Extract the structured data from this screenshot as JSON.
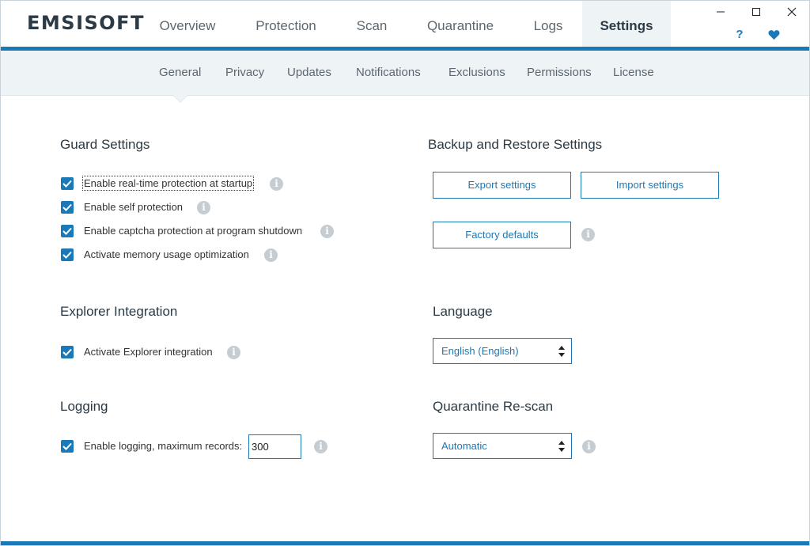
{
  "app": {
    "logo": "EMSISOFT"
  },
  "main_tabs": [
    "Overview",
    "Protection",
    "Scan",
    "Quarantine",
    "Logs",
    "Settings"
  ],
  "active_tab": "Settings",
  "window_controls": {
    "minimize": "minimize",
    "maximize": "maximize",
    "close": "close"
  },
  "header_icons": {
    "help": "?",
    "favorite": "heart-icon"
  },
  "sub_tabs": [
    "General",
    "Privacy",
    "Updates",
    "Notifications",
    "Exclusions",
    "Permissions",
    "License"
  ],
  "active_sub_tab": "General",
  "guard": {
    "title": "Guard Settings",
    "items": [
      {
        "label": "Enable real-time protection at startup",
        "checked": true
      },
      {
        "label": "Enable self protection",
        "checked": true
      },
      {
        "label": "Enable captcha protection at program shutdown",
        "checked": true
      },
      {
        "label": "Activate memory usage optimization",
        "checked": true
      }
    ]
  },
  "explorer": {
    "title": "Explorer Integration",
    "items": [
      {
        "label": "Activate Explorer integration",
        "checked": true
      }
    ]
  },
  "logging": {
    "title": "Logging",
    "label": "Enable logging, maximum records:",
    "checked": true,
    "max_records": "300"
  },
  "backup": {
    "title": "Backup and Restore Settings",
    "export_label": "Export settings",
    "import_label": "Import settings",
    "factory_label": "Factory defaults"
  },
  "language": {
    "title": "Language",
    "selected": "English (English)"
  },
  "quarantine_rescan": {
    "title": "Quarantine Re-scan",
    "selected": "Automatic"
  },
  "info_glyph": "i",
  "colors": {
    "accent": "#1a79b6",
    "subnav_bg": "#eef3f5",
    "info_icon": "#c6cdd2"
  }
}
